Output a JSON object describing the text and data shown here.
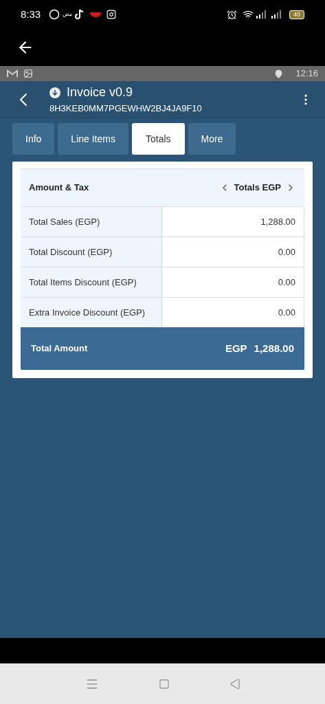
{
  "status_bar": {
    "time": "8:33",
    "notification_text": "نبض",
    "battery": "40"
  },
  "inner_status_bar": {
    "time": "12:16"
  },
  "header": {
    "title": "Invoice v0.9",
    "subtitle": "8H3KEB0MM7PGEWHW2BJ4JA9F10"
  },
  "tabs": [
    {
      "label": "Info",
      "selected": false
    },
    {
      "label": "Line Items",
      "selected": false
    },
    {
      "label": "Totals",
      "selected": true
    },
    {
      "label": "More",
      "selected": false
    }
  ],
  "table": {
    "heading": "Amount & Tax",
    "selector": "Totals EGP",
    "rows": [
      {
        "label": "Total Sales (EGP)",
        "value": "1,288.00"
      },
      {
        "label": "Total Discount (EGP)",
        "value": "0.00"
      },
      {
        "label": "Total Items Discount (EGP)",
        "value": "0.00"
      },
      {
        "label": "Extra Invoice Discount (EGP)",
        "value": "0.00"
      }
    ],
    "total": {
      "label": "Total Amount",
      "currency": "EGP",
      "value": "1,288.00"
    }
  }
}
